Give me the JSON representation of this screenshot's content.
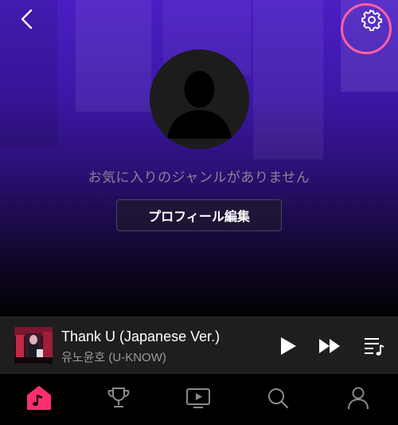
{
  "header": {
    "back_icon": "chevron-left-icon",
    "settings_icon": "gear-icon",
    "highlight_color": "#ff5fa2"
  },
  "profile": {
    "avatar_icon": "default-avatar-silhouette",
    "empty_genre_text": "お気に入りのジャンルがありません",
    "edit_profile_label": "プロフィール編集"
  },
  "player": {
    "title": "Thank U (Japanese Ver.)",
    "artist": "유노윤호 (U-KNOW)",
    "play_icon": "play-icon",
    "next_icon": "fast-forward-icon",
    "queue_icon": "playlist-icon"
  },
  "tabs": [
    {
      "icon": "music-note-home-icon",
      "active": true
    },
    {
      "icon": "trophy-icon",
      "active": false
    },
    {
      "icon": "video-play-icon",
      "active": false
    },
    {
      "icon": "search-icon",
      "active": false
    },
    {
      "icon": "person-icon",
      "active": false
    }
  ],
  "colors": {
    "accent": "#ff2f6e",
    "gradient_top": "#4a1ec4",
    "player_bg": "#1e1e1e"
  }
}
